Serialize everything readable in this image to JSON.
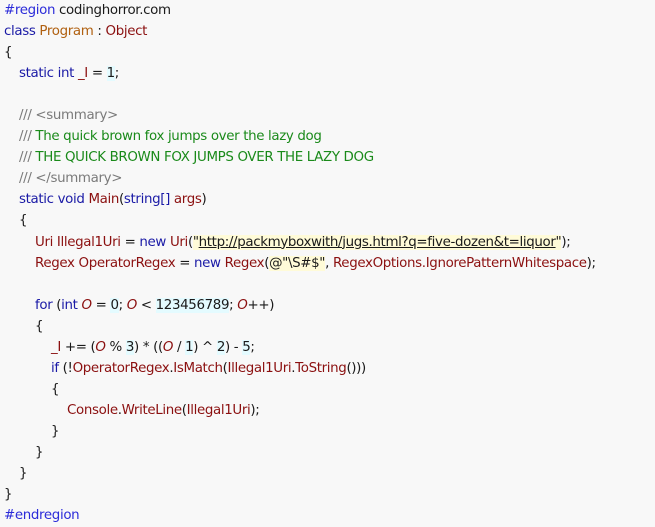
{
  "editor": {
    "colors": {
      "background": "#f8f8f8",
      "keyword": "#1a1aa6",
      "preprocessor": "#2b2bd9",
      "type": "#b06010",
      "identifier": "#8b1010",
      "doc_tag": "#7a7a7a",
      "comment": "#1a8a1a",
      "string_bg": "#fffbd8",
      "number_bg": "#e4fbff"
    },
    "lines": {
      "l1": {
        "directive": "#region",
        "name": "codinghorror.com"
      },
      "l2": {
        "kw_class": "class",
        "class_name": "Program",
        "colon": ":",
        "base": "Object"
      },
      "l3": {
        "brace": "{"
      },
      "l4": {
        "kw_static": "static",
        "kw_int": "int",
        "field": "_I",
        "eq": "=",
        "value": "1",
        "semi": ";"
      },
      "l5": {},
      "l6": {
        "prefix": "///",
        "tag": "<summary>"
      },
      "l7": {
        "prefix": "///",
        "text": "The quick brown fox jumps over the lazy dog"
      },
      "l8": {
        "prefix": "///",
        "text": "THE QUICK BROWN FOX JUMPS OVER THE LAZY DOG"
      },
      "l9": {
        "prefix": "///",
        "tag": "</summary>"
      },
      "l10": {
        "kw_static": "static",
        "kw_void": "void",
        "method": "Main",
        "open": "(",
        "kw_string": "string[]",
        "param": "args",
        "close": ")"
      },
      "l11": {
        "brace": "{"
      },
      "l12": {
        "type": "Uri",
        "var": "Illegal1Uri",
        "eq": "=",
        "kw_new": "new",
        "ctor": "Uri",
        "open": "(",
        "quote_open": "\"",
        "url": "http://packmyboxwith/jugs.html?q=five-dozen&t=liquor",
        "quote_close": "\"",
        "end": ");"
      },
      "l13": {
        "type": "Regex",
        "var": "OperatorRegex",
        "eq": "=",
        "kw_new": "new",
        "ctor": "Regex",
        "open": "(",
        "str": "@\"\\S#$\"",
        "comma": ",",
        "enum": "RegexOptions.IgnorePatternWhitespace",
        "end": ");"
      },
      "l14": {},
      "l15": {
        "kw_for": "for",
        "open": "(",
        "kw_int": "int",
        "var": "O",
        "eq": "=",
        "zero": "0",
        "semi1": ";",
        "var2": "O",
        "lt": "<",
        "limit": "123456789",
        "semi2": ";",
        "var3": "O",
        "inc": "++",
        "close": ")"
      },
      "l16": {
        "brace": "{"
      },
      "l17": {
        "field": "_I",
        "op": "+=",
        "p1": "(",
        "var": "O",
        "mod": "%",
        "three": "3",
        "p2": ")",
        "mul": "*",
        "p3": "((",
        "var2": "O",
        "div": "/",
        "one": "1",
        "p4": ")",
        "xor": "^",
        "two": "2",
        "p5": ")",
        "minus": "-",
        "five": "5",
        "semi": ";"
      },
      "l18": {
        "kw_if": "if",
        "open": "(!",
        "obj": "OperatorRegex",
        "dot": ".",
        "method": "IsMatch",
        "p1": "(",
        "arg": "Illegal1Uri",
        "dot2": ".",
        "method2": "ToString",
        "end": "()))"
      },
      "l19": {
        "brace": "{"
      },
      "l20": {
        "obj": "Console",
        "dot": ".",
        "method": "WriteLine",
        "open": "(",
        "arg": "Illegal1Uri",
        "end": ");"
      },
      "l21": {
        "brace": "}"
      },
      "l22": {
        "brace": "}"
      },
      "l23": {
        "brace": "}"
      },
      "l24": {
        "brace": "}"
      },
      "l25": {
        "directive": "#endregion"
      }
    }
  }
}
